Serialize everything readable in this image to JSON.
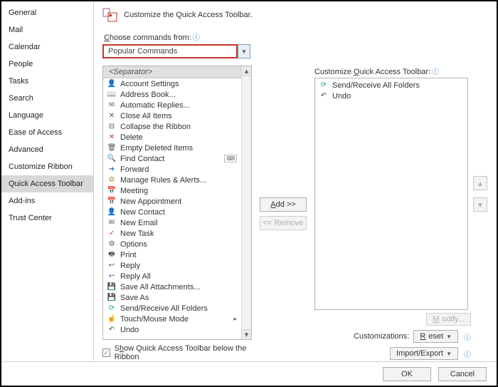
{
  "sidebar": {
    "items": [
      {
        "label": "General"
      },
      {
        "label": "Mail"
      },
      {
        "label": "Calendar"
      },
      {
        "label": "People"
      },
      {
        "label": "Tasks"
      },
      {
        "label": "Search"
      },
      {
        "label": "Language"
      },
      {
        "label": "Ease of Access"
      },
      {
        "label": "Advanced"
      },
      {
        "label": "Customize Ribbon"
      },
      {
        "label": "Quick Access Toolbar"
      },
      {
        "label": "Add-ins"
      },
      {
        "label": "Trust Center"
      }
    ],
    "selected_index": 10
  },
  "header": {
    "title": "Customize the Quick Access Toolbar."
  },
  "choose": {
    "label_pre": "",
    "label_u": "C",
    "label_post": "hoose commands from:",
    "value": "Popular Commands"
  },
  "left_list": {
    "header": "<Separator>",
    "items": [
      {
        "label": "Account Settings"
      },
      {
        "label": "Address Book..."
      },
      {
        "label": "Automatic Replies..."
      },
      {
        "label": "Close All Items"
      },
      {
        "label": "Collapse the Ribbon"
      },
      {
        "label": "Delete"
      },
      {
        "label": "Empty Deleted Items"
      },
      {
        "label": "Find Contact",
        "badge": true
      },
      {
        "label": "Forward"
      },
      {
        "label": "Manage Rules & Alerts..."
      },
      {
        "label": "Meeting"
      },
      {
        "label": "New Appointment"
      },
      {
        "label": "New Contact"
      },
      {
        "label": "New Email"
      },
      {
        "label": "New Task"
      },
      {
        "label": "Options"
      },
      {
        "label": "Print"
      },
      {
        "label": "Reply"
      },
      {
        "label": "Reply All"
      },
      {
        "label": "Save All Attachments..."
      },
      {
        "label": "Save As"
      },
      {
        "label": "Send/Receive All Folders"
      },
      {
        "label": "Touch/Mouse Mode",
        "submenu": true
      },
      {
        "label": "Undo"
      }
    ]
  },
  "mid": {
    "add": "Add >>",
    "remove": "<< Remove"
  },
  "right": {
    "label_pre": "Customize ",
    "label_u": "Q",
    "label_post": "uick Access Toolbar:",
    "items": [
      {
        "label": "Send/Receive All Folders"
      },
      {
        "label": "Undo"
      }
    ],
    "modify": "Modify...",
    "customizations_label": "Customizations:",
    "reset": "Reset",
    "import_export": "Import/Export"
  },
  "show_below": {
    "label_pre": "S",
    "label_u": "h",
    "label_post": "ow Quick Access Toolbar below the Ribbon",
    "checked": true
  },
  "footer": {
    "ok": "OK",
    "cancel": "Cancel"
  }
}
